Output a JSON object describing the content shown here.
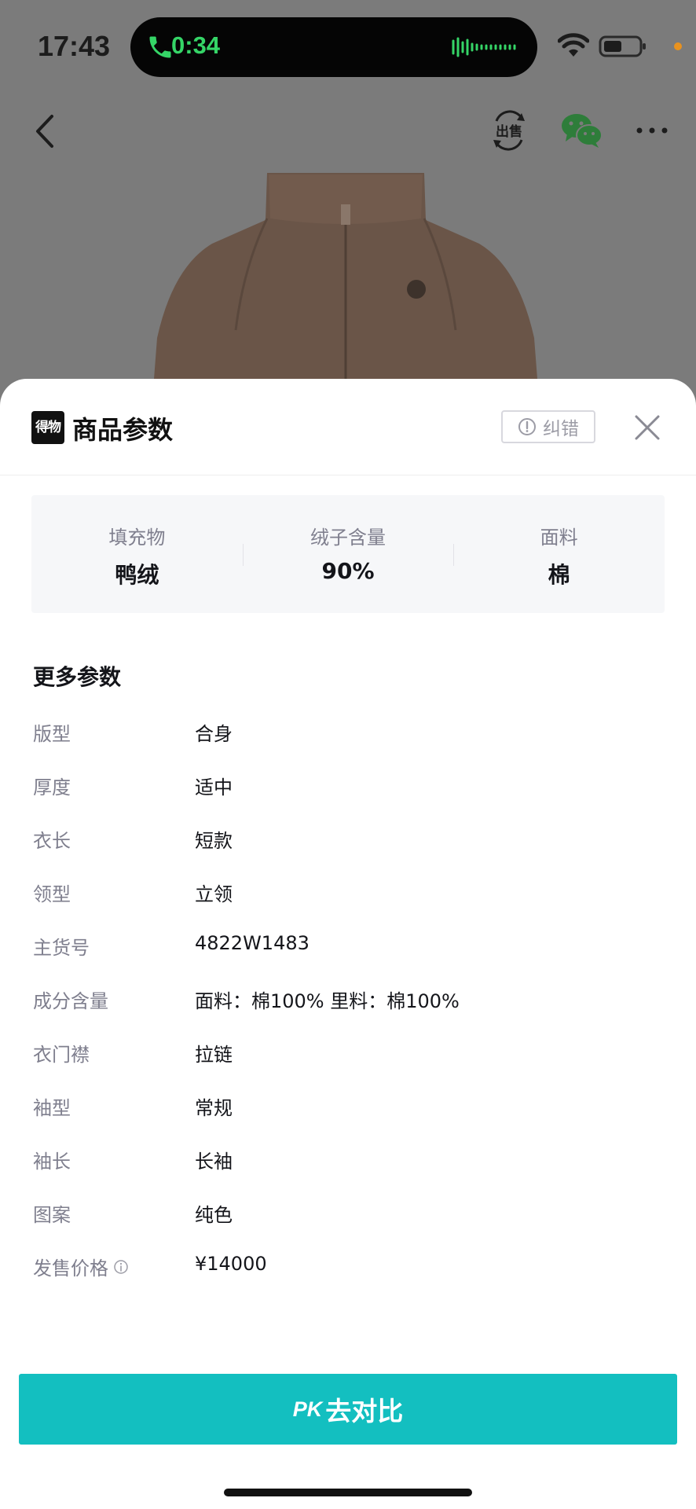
{
  "status_bar": {
    "time": "17:43",
    "call_timer": "0:34",
    "accent_green": "#35d567",
    "icons": [
      "phone-icon",
      "audio-wave-icon",
      "wifi-icon",
      "battery-icon"
    ]
  },
  "nav": {
    "icons": [
      "back-icon",
      "sell-icon",
      "wechat-icon",
      "more-icon"
    ]
  },
  "sheet": {
    "brand_logo": "得物",
    "title": "商品参数",
    "report_label": "纠错",
    "key_params": [
      {
        "label": "填充物",
        "value": "鸭绒"
      },
      {
        "label": "绒子含量",
        "value": "90%"
      },
      {
        "label": "面料",
        "value": "棉"
      }
    ],
    "more_title": "更多参数",
    "params": [
      {
        "label": "版型",
        "value": "合身"
      },
      {
        "label": "厚度",
        "value": "适中"
      },
      {
        "label": "衣长",
        "value": "短款"
      },
      {
        "label": "领型",
        "value": "立领"
      },
      {
        "label": "主货号",
        "value": "4822W1483"
      },
      {
        "label": "成分含量",
        "value": "面料：棉100% 里料：棉100%"
      },
      {
        "label": "衣门襟",
        "value": "拉链"
      },
      {
        "label": "袖型",
        "value": "常规"
      },
      {
        "label": "袖长",
        "value": "长袖"
      },
      {
        "label": "图案",
        "value": "纯色"
      },
      {
        "label": "发售价格",
        "value": "¥14000"
      }
    ],
    "pk_prefix": "PK",
    "pk_label": "去对比",
    "accent_teal": "#13bfc0"
  }
}
